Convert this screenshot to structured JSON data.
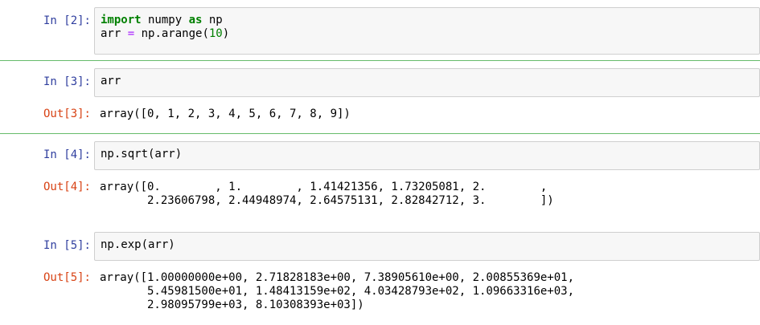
{
  "cells": [
    {
      "in_prompt": "In  [2]:",
      "code_lines": [
        {
          "kw1": "import",
          "t1": " numpy ",
          "kw2": "as",
          "t2": " np"
        },
        {
          "t1": "arr ",
          "op": "=",
          "t2": " np.arange(",
          "num": "10",
          "t3": ")"
        }
      ]
    },
    {
      "in_prompt": "In  [3]:",
      "code": "arr",
      "out_prompt": "Out[3]:",
      "output": [
        "array([0, 1, 2, 3, 4, 5, 6, 7, 8, 9])"
      ]
    },
    {
      "in_prompt": "In  [4]:",
      "code": "np.sqrt(arr)",
      "out_prompt": "Out[4]:",
      "output": [
        "array([0.        , 1.        , 1.41421356, 1.73205081, 2.        ,",
        "       2.23606798, 2.44948974, 2.64575131, 2.82842712, 3.        ])"
      ]
    },
    {
      "in_prompt": "In  [5]:",
      "code": "np.exp(arr)",
      "out_prompt": "Out[5]:",
      "output": [
        "array([1.00000000e+00, 2.71828183e+00, 7.38905610e+00, 2.00855369e+01,",
        "       5.45981500e+01, 1.48413159e+02, 4.03428793e+02, 1.09663316e+03,",
        "       2.98095799e+03, 8.10308393e+03])"
      ]
    }
  ],
  "colors": {
    "in_prompt": "#303f9f",
    "out_prompt": "#d84315",
    "keyword": "#008000",
    "operator": "#aa22ff",
    "number": "#008000",
    "separator": "#66bb6a",
    "input_bg": "#f7f7f7"
  }
}
